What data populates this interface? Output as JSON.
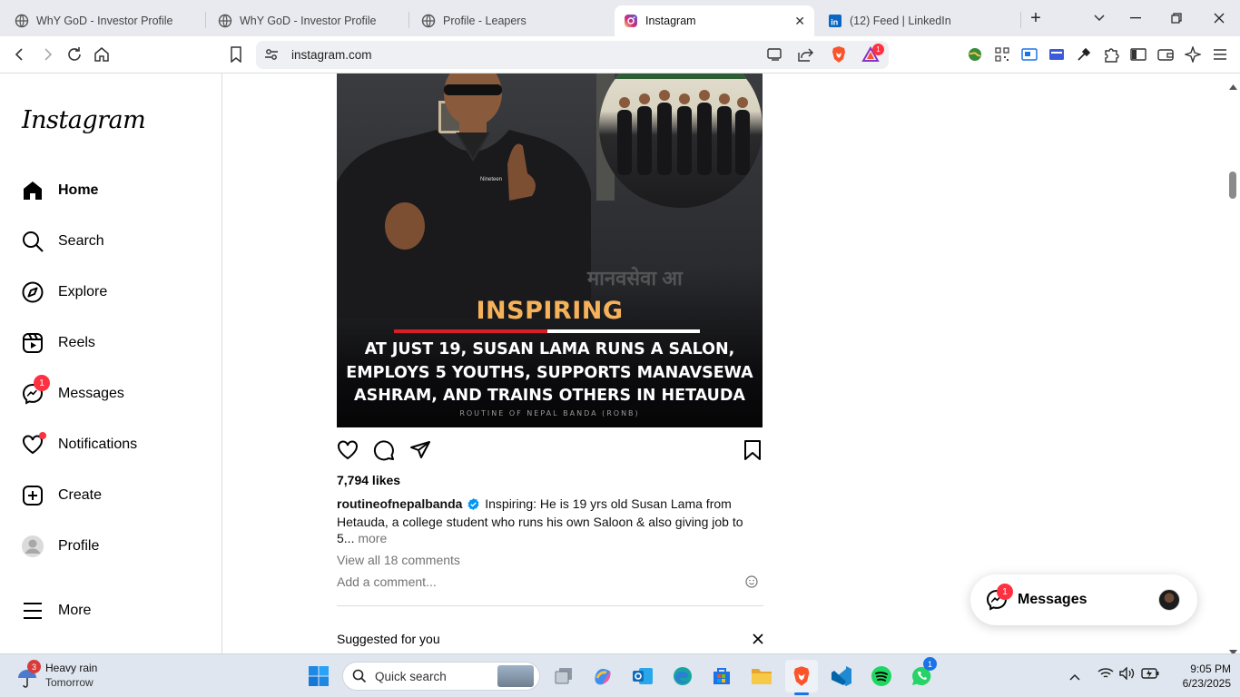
{
  "browser": {
    "tabs": [
      {
        "title": "WhY GoD - Investor Profile",
        "icon": "globe-icon"
      },
      {
        "title": "WhY GoD - Investor Profile",
        "icon": "globe-icon"
      },
      {
        "title": "Profile - Leapers",
        "icon": "globe-icon"
      },
      {
        "title": "Instagram",
        "icon": "instagram-icon",
        "active": true
      },
      {
        "title": "(12) Feed | LinkedIn",
        "icon": "linkedin-icon"
      }
    ],
    "url": "instagram.com",
    "brave_badge": "1"
  },
  "instagram": {
    "logo": "Instagram",
    "nav": [
      {
        "label": "Home",
        "icon": "home-icon"
      },
      {
        "label": "Search",
        "icon": "search-icon"
      },
      {
        "label": "Explore",
        "icon": "compass-icon"
      },
      {
        "label": "Reels",
        "icon": "reels-icon"
      },
      {
        "label": "Messages",
        "icon": "messenger-icon",
        "badge": "1"
      },
      {
        "label": "Notifications",
        "icon": "heart-icon"
      },
      {
        "label": "Create",
        "icon": "plus-square-icon"
      },
      {
        "label": "Profile",
        "icon": "avatar-icon"
      },
      {
        "label": "More",
        "icon": "hamburger-icon"
      }
    ],
    "post": {
      "image_tag": "INSPIRING",
      "image_headline": [
        "AT JUST 19, SUSAN LAMA RUNS A SALON,",
        "EMPLOYS 5 YOUTHS, SUPPORTS MANAVSEWA",
        "ASHRAM, AND TRAINS OTHERS IN HETAUDA"
      ],
      "image_footer": "ROUTINE OF NEPAL BANDA (RONB)",
      "shirt_text": "The Nineteen Saloon",
      "likes": "7,794 likes",
      "username": "routineofnepalbanda",
      "caption": "Inspiring: He is 19 yrs old Susan Lama from Hetauda, a college student who runs his own Saloon & also giving job to 5...",
      "more": "more",
      "view_comments": "View all 18 comments",
      "add_comment": "Add a comment..."
    },
    "suggested": "Suggested for you",
    "messages_pill": {
      "label": "Messages",
      "badge": "1"
    }
  },
  "taskbar": {
    "weather": {
      "badge": "3",
      "title": "Heavy rain",
      "subtitle": "Tomorrow"
    },
    "search_placeholder": "Quick search",
    "whatsapp_badge": "1",
    "time": "9:05 PM",
    "date": "6/23/2025"
  },
  "colors": {
    "accent_red": "#ff3040",
    "brave_orange": "#fb542b",
    "verified_blue": "#0095f6",
    "inspiring_orange": "#f6b25a"
  }
}
